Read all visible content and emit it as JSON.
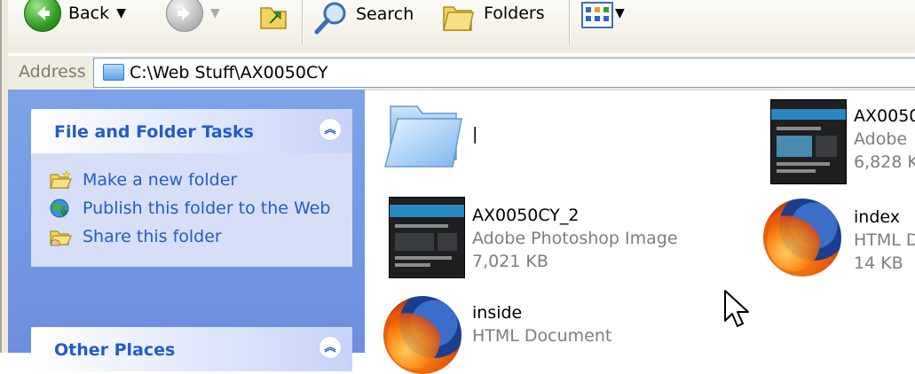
{
  "toolbar": {
    "back_label": "Back",
    "search_label": "Search",
    "folders_label": "Folders"
  },
  "address": {
    "label": "Address",
    "path": "C:\\Web Stuff\\AX0050CY"
  },
  "taskpane": {
    "file_tasks": {
      "title": "File and Folder Tasks",
      "items": [
        {
          "label": "Make a new folder",
          "icon": "new-folder-icon"
        },
        {
          "label": "Publish this folder to the Web",
          "icon": "publish-web-icon"
        },
        {
          "label": "Share this folder",
          "icon": "share-folder-icon"
        }
      ]
    },
    "other_places": {
      "title": "Other Places"
    }
  },
  "files": [
    {
      "name": "|",
      "type": "",
      "size": "",
      "icon": "folder-icon"
    },
    {
      "name": "AX0050",
      "type": "Adobe",
      "size": "6,828 K",
      "icon": "psd-thumbnail"
    },
    {
      "name": "AX0050CY_2",
      "type": "Adobe Photoshop Image",
      "size": "7,021 KB",
      "icon": "psd-thumbnail"
    },
    {
      "name": "index",
      "type": "HTML D",
      "size": "14 KB",
      "icon": "firefox-icon"
    },
    {
      "name": "inside",
      "type": "HTML Document",
      "size": "",
      "icon": "firefox-icon"
    }
  ],
  "colors": {
    "task_link": "#215dc6",
    "taskpane_bg": "#d6dff7",
    "toolbar_bg": "#efede2"
  }
}
